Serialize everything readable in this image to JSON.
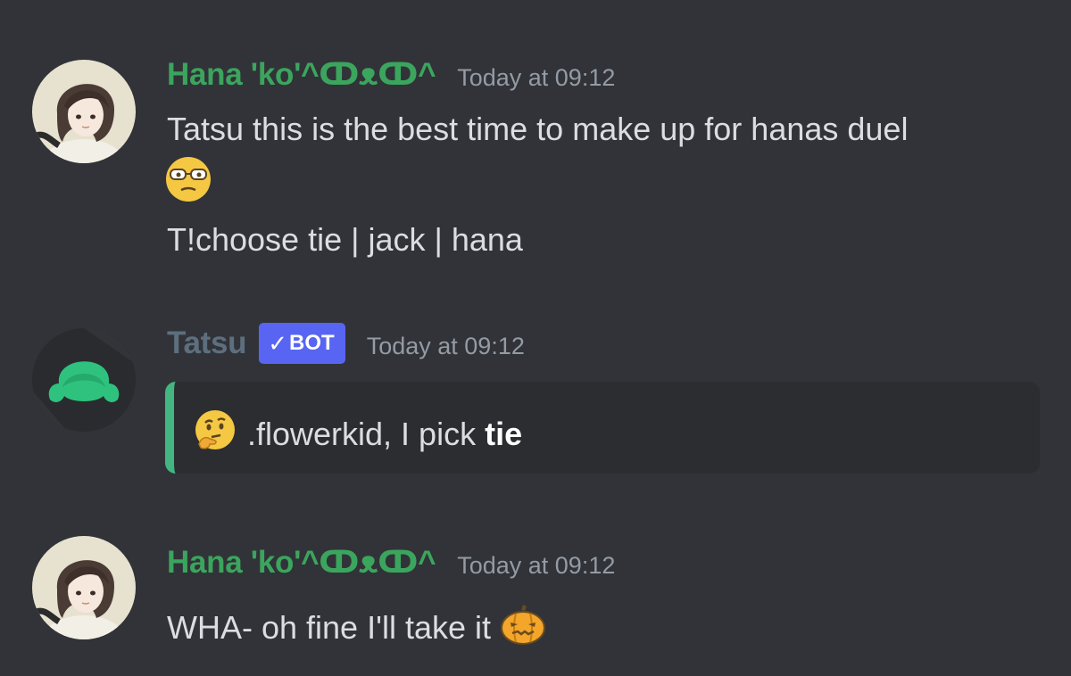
{
  "messages": [
    {
      "author": "Hana 'ko'^ↀᴥↀ^",
      "author_color": "#3ba55d",
      "timestamp": "Today at 09:12",
      "lines": [
        "Tatsu this is the best time to make up for hanas duel",
        "T!choose tie | jack | hana"
      ],
      "emoji": "suspicious-glasses-face"
    },
    {
      "author": "Tatsu",
      "author_color": "#5d6f7e",
      "badge": "BOT",
      "badge_check": "✓",
      "timestamp": "Today at 09:12",
      "embed": {
        "emoji": "thinking-face",
        "prefix": ".flowerkid, I pick ",
        "choice": "tie",
        "accent_color": "#43b581"
      }
    },
    {
      "author": "Hana 'ko'^ↀᴥↀ^",
      "author_color": "#3ba55d",
      "timestamp": "Today at 09:12",
      "lines": [
        "WHA- oh fine I'll take it"
      ],
      "emoji": "pumpkin-face"
    }
  ],
  "colors": {
    "background": "#313338",
    "text": "#dbdee1",
    "timestamp": "#949ba4",
    "bot_badge": "#5865f2",
    "embed_background": "#2b2d31"
  }
}
